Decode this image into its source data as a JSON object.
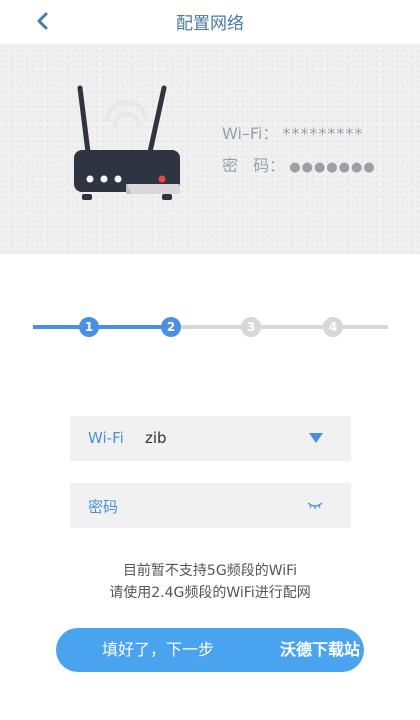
{
  "header": {
    "title": "配置网络",
    "back_icon": "chevron-left-icon"
  },
  "hero": {
    "wifi_label": "Wi–Fi",
    "wifi_sep": "：",
    "wifi_mask": "*********",
    "pwd_label": "密   码",
    "pwd_sep": "：",
    "pwd_mask": "●●●●●●●"
  },
  "steps": {
    "labels": [
      "1",
      "2",
      "3",
      "4"
    ],
    "current": 2,
    "active_color": "#4a90e2",
    "inactive_color": "#d8d8d8"
  },
  "form": {
    "wifi_label": "Wi-Fi",
    "wifi_value": "zib",
    "pwd_label": "密码",
    "dropdown_icon": "triangle-down-icon",
    "eye_icon": "eye-closed-icon"
  },
  "notice": {
    "line1": "目前暂不支持5G频段的WiFi",
    "line2": "请使用2.4G频段的WiFi进行配网"
  },
  "next_button": {
    "label": "填好了，下一步"
  },
  "watermark": "沃德下载站",
  "colors": {
    "accent": "#4a90e2",
    "button": "#4aa3ef",
    "nav_title": "#4a79a4"
  }
}
